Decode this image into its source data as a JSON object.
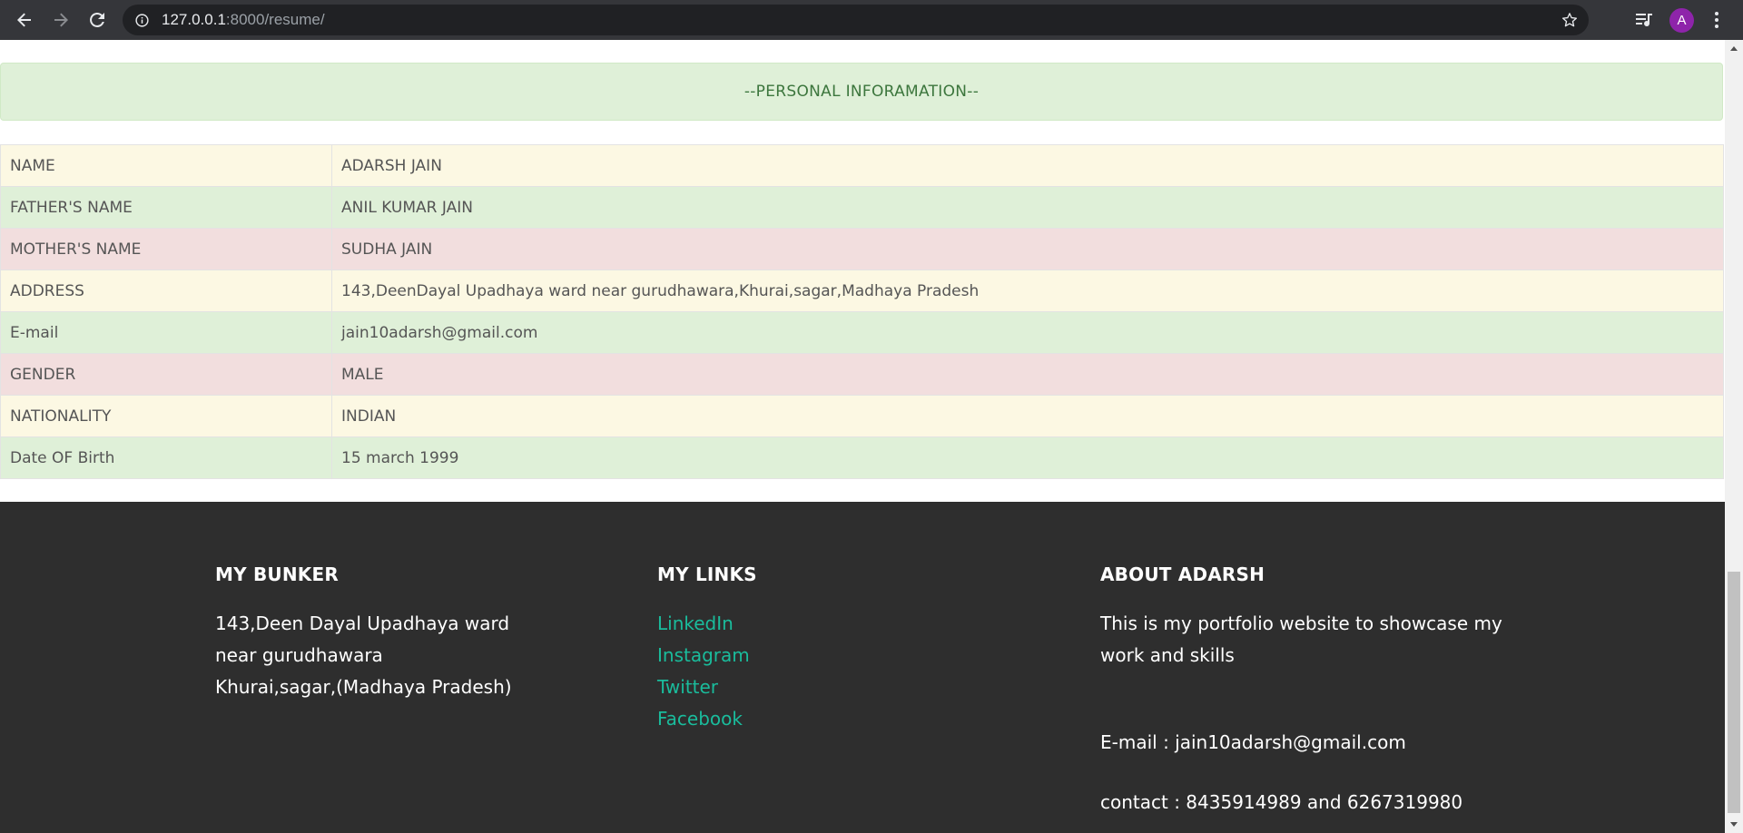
{
  "browser": {
    "url_host": "127.0.0.1",
    "url_rest": ":8000/resume/",
    "profile_initial": "A",
    "profile_color": "#8e24aa"
  },
  "section": {
    "title": "--PERSONAL INFORAMATION--"
  },
  "personal_info": {
    "rows": [
      {
        "label": "NAME",
        "value": "ADARSH JAIN",
        "style": "warning"
      },
      {
        "label": "FATHER'S NAME",
        "value": "ANIL KUMAR JAIN",
        "style": "success"
      },
      {
        "label": "MOTHER'S NAME",
        "value": "SUDHA JAIN",
        "style": "danger"
      },
      {
        "label": "ADDRESS",
        "value": "143,DeenDayal Upadhaya ward near gurudhawara,Khurai,sagar,Madhaya Pradesh",
        "style": "warning"
      },
      {
        "label": "E-mail",
        "value": "jain10adarsh@gmail.com",
        "style": "success"
      },
      {
        "label": "GENDER",
        "value": "MALE",
        "style": "danger"
      },
      {
        "label": "NATIONALITY",
        "value": "INDIAN",
        "style": "warning"
      },
      {
        "label": "Date OF Birth",
        "value": "15 march 1999",
        "style": "success"
      }
    ]
  },
  "footer": {
    "bunker": {
      "title": "MY BUNKER",
      "lines": [
        "143,Deen Dayal Upadhaya ward",
        "near gurudhawara",
        "Khurai,sagar,(Madhaya Pradesh)"
      ]
    },
    "links": {
      "title": "MY LINKS",
      "items": [
        "LinkedIn",
        "Instagram",
        "Twitter",
        "Facebook"
      ]
    },
    "about": {
      "title": "ABOUT ADARSH",
      "description": "This is my portfolio website to showcase my work and skills",
      "email": "E-mail : jain10adarsh@gmail.com",
      "contact": "contact : 8435914989 and 6267319980"
    }
  },
  "colors": {
    "footer_bg": "#2e2e2e",
    "link": "#1abc9c",
    "header_text": "#3c763d",
    "row_warning": "#fcf8e3",
    "row_success": "#dff0d8",
    "row_danger": "#f2dede"
  }
}
